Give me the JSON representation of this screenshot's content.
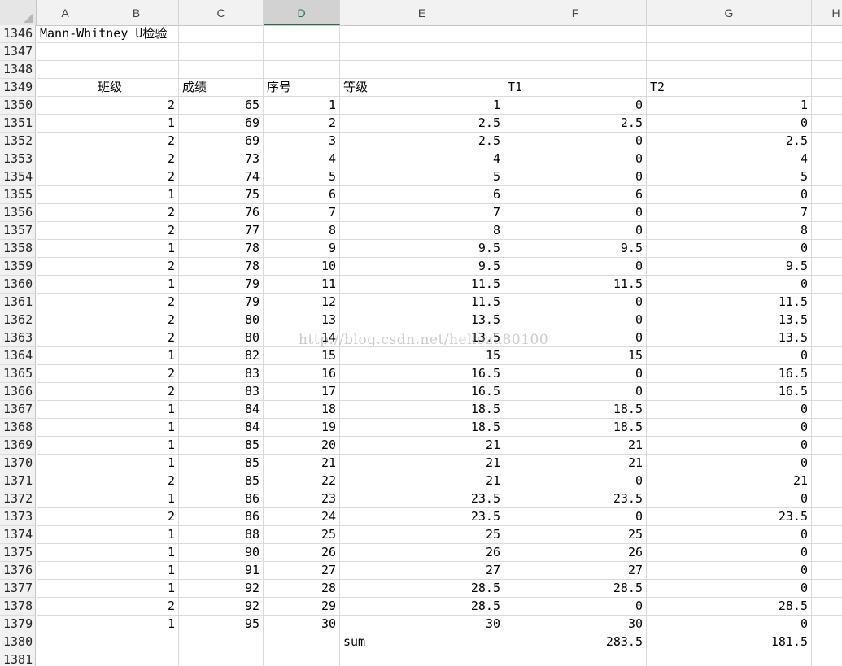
{
  "columns": [
    "A",
    "B",
    "C",
    "D",
    "E",
    "F",
    "G",
    "H"
  ],
  "selected_column": "D",
  "rows": [
    {
      "n": "1346",
      "A": "Mann-Whitney U检验",
      "B": "",
      "C": "",
      "D": "",
      "E": "",
      "F": "",
      "G": ""
    },
    {
      "n": "1347",
      "A": "",
      "B": "",
      "C": "",
      "D": "",
      "E": "",
      "F": "",
      "G": ""
    },
    {
      "n": "1348",
      "A": "",
      "B": "",
      "C": "",
      "D": "",
      "E": "",
      "F": "",
      "G": ""
    },
    {
      "n": "1349",
      "A": "",
      "B": "班级",
      "C": "成绩",
      "D": "序号",
      "E": "等级",
      "F": "T1",
      "G": "T2"
    },
    {
      "n": "1350",
      "A": "",
      "B": "2",
      "C": "65",
      "D": "1",
      "E": "1",
      "F": "0",
      "G": "1"
    },
    {
      "n": "1351",
      "A": "",
      "B": "1",
      "C": "69",
      "D": "2",
      "E": "2.5",
      "F": "2.5",
      "G": "0"
    },
    {
      "n": "1352",
      "A": "",
      "B": "2",
      "C": "69",
      "D": "3",
      "E": "2.5",
      "F": "0",
      "G": "2.5"
    },
    {
      "n": "1353",
      "A": "",
      "B": "2",
      "C": "73",
      "D": "4",
      "E": "4",
      "F": "0",
      "G": "4"
    },
    {
      "n": "1354",
      "A": "",
      "B": "2",
      "C": "74",
      "D": "5",
      "E": "5",
      "F": "0",
      "G": "5"
    },
    {
      "n": "1355",
      "A": "",
      "B": "1",
      "C": "75",
      "D": "6",
      "E": "6",
      "F": "6",
      "G": "0"
    },
    {
      "n": "1356",
      "A": "",
      "B": "2",
      "C": "76",
      "D": "7",
      "E": "7",
      "F": "0",
      "G": "7"
    },
    {
      "n": "1357",
      "A": "",
      "B": "2",
      "C": "77",
      "D": "8",
      "E": "8",
      "F": "0",
      "G": "8"
    },
    {
      "n": "1358",
      "A": "",
      "B": "1",
      "C": "78",
      "D": "9",
      "E": "9.5",
      "F": "9.5",
      "G": "0"
    },
    {
      "n": "1359",
      "A": "",
      "B": "2",
      "C": "78",
      "D": "10",
      "E": "9.5",
      "F": "0",
      "G": "9.5"
    },
    {
      "n": "1360",
      "A": "",
      "B": "1",
      "C": "79",
      "D": "11",
      "E": "11.5",
      "F": "11.5",
      "G": "0"
    },
    {
      "n": "1361",
      "A": "",
      "B": "2",
      "C": "79",
      "D": "12",
      "E": "11.5",
      "F": "0",
      "G": "11.5"
    },
    {
      "n": "1362",
      "A": "",
      "B": "2",
      "C": "80",
      "D": "13",
      "E": "13.5",
      "F": "0",
      "G": "13.5"
    },
    {
      "n": "1363",
      "A": "",
      "B": "2",
      "C": "80",
      "D": "14",
      "E": "13.5",
      "F": "0",
      "G": "13.5"
    },
    {
      "n": "1364",
      "A": "",
      "B": "1",
      "C": "82",
      "D": "15",
      "E": "15",
      "F": "15",
      "G": "0"
    },
    {
      "n": "1365",
      "A": "",
      "B": "2",
      "C": "83",
      "D": "16",
      "E": "16.5",
      "F": "0",
      "G": "16.5"
    },
    {
      "n": "1366",
      "A": "",
      "B": "2",
      "C": "83",
      "D": "17",
      "E": "16.5",
      "F": "0",
      "G": "16.5"
    },
    {
      "n": "1367",
      "A": "",
      "B": "1",
      "C": "84",
      "D": "18",
      "E": "18.5",
      "F": "18.5",
      "G": "0"
    },
    {
      "n": "1368",
      "A": "",
      "B": "1",
      "C": "84",
      "D": "19",
      "E": "18.5",
      "F": "18.5",
      "G": "0"
    },
    {
      "n": "1369",
      "A": "",
      "B": "1",
      "C": "85",
      "D": "20",
      "E": "21",
      "F": "21",
      "G": "0"
    },
    {
      "n": "1370",
      "A": "",
      "B": "1",
      "C": "85",
      "D": "21",
      "E": "21",
      "F": "21",
      "G": "0"
    },
    {
      "n": "1371",
      "A": "",
      "B": "2",
      "C": "85",
      "D": "22",
      "E": "21",
      "F": "0",
      "G": "21"
    },
    {
      "n": "1372",
      "A": "",
      "B": "1",
      "C": "86",
      "D": "23",
      "E": "23.5",
      "F": "23.5",
      "G": "0"
    },
    {
      "n": "1373",
      "A": "",
      "B": "2",
      "C": "86",
      "D": "24",
      "E": "23.5",
      "F": "0",
      "G": "23.5"
    },
    {
      "n": "1374",
      "A": "",
      "B": "1",
      "C": "88",
      "D": "25",
      "E": "25",
      "F": "25",
      "G": "0"
    },
    {
      "n": "1375",
      "A": "",
      "B": "1",
      "C": "90",
      "D": "26",
      "E": "26",
      "F": "26",
      "G": "0"
    },
    {
      "n": "1376",
      "A": "",
      "B": "1",
      "C": "91",
      "D": "27",
      "E": "27",
      "F": "27",
      "G": "0"
    },
    {
      "n": "1377",
      "A": "",
      "B": "1",
      "C": "92",
      "D": "28",
      "E": "28.5",
      "F": "28.5",
      "G": "0"
    },
    {
      "n": "1378",
      "A": "",
      "B": "2",
      "C": "92",
      "D": "29",
      "E": "28.5",
      "F": "0",
      "G": "28.5"
    },
    {
      "n": "1379",
      "A": "",
      "B": "1",
      "C": "95",
      "D": "30",
      "E": "30",
      "F": "30",
      "G": "0"
    },
    {
      "n": "1380",
      "A": "",
      "B": "",
      "C": "",
      "D": "",
      "E": "sum",
      "F": "283.5",
      "G": "181.5"
    },
    {
      "n": "1381",
      "A": "",
      "B": "",
      "C": "",
      "D": "",
      "E": "",
      "F": "",
      "G": ""
    }
  ],
  "watermark": "http://blog.csdn.net/hellozu80100",
  "colors": {
    "header_bg": "#f2f2f2",
    "selected_accent": "#217346",
    "gridline": "#dadada"
  }
}
